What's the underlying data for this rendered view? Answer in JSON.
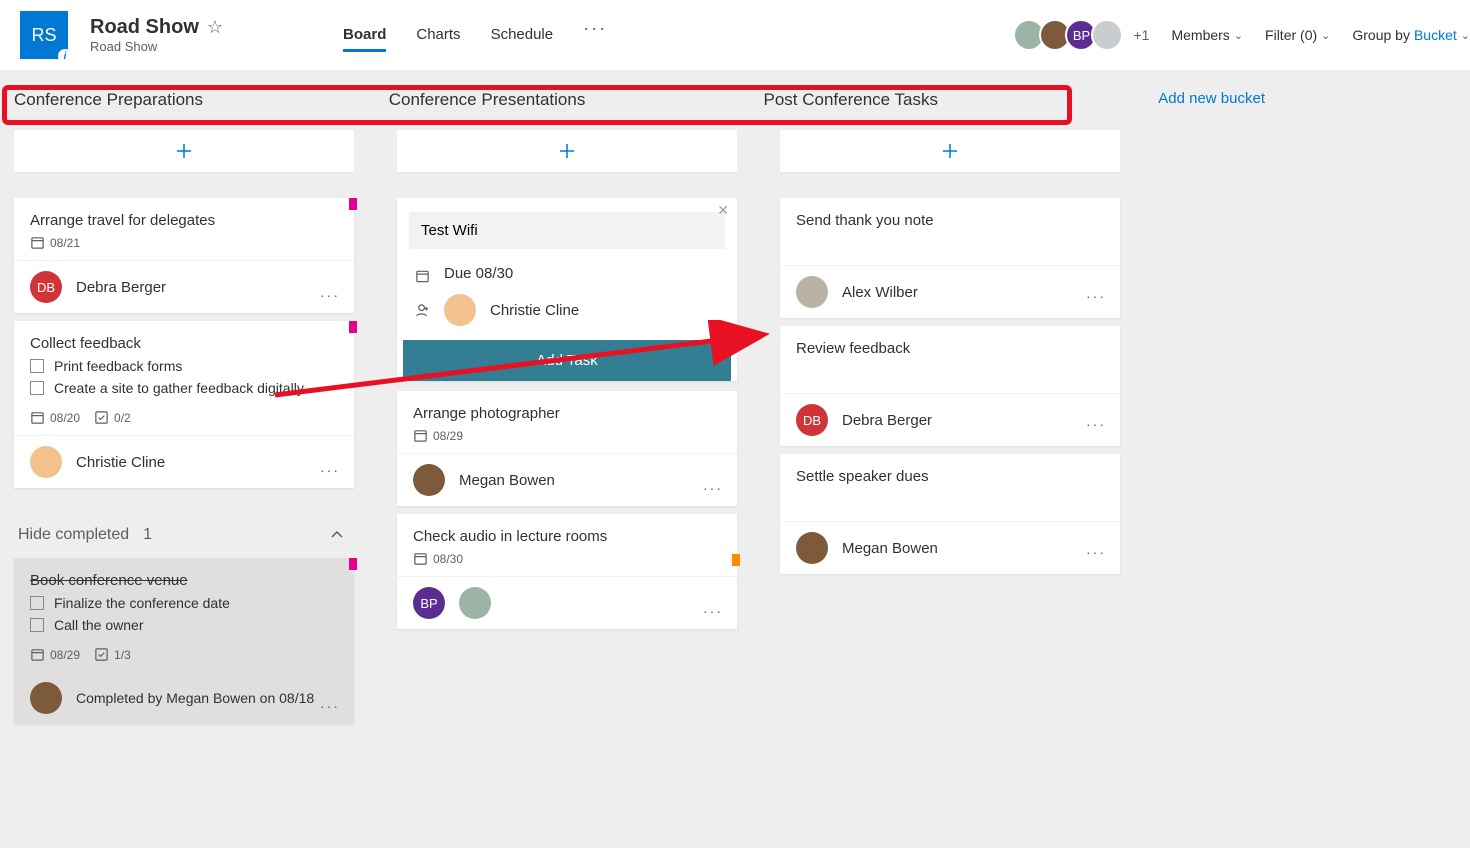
{
  "header": {
    "planInitials": "RS",
    "planTitle": "Road Show",
    "planSub": "Road Show",
    "tabs": {
      "board": "Board",
      "charts": "Charts",
      "schedule": "Schedule"
    },
    "plusCount": "+1",
    "members": "Members",
    "filter": "Filter (0)",
    "groupBy": "Group by",
    "groupByValue": "Bucket"
  },
  "buckets": {
    "confPrep": "Conference Preparations",
    "confPres": "Conference Presentations",
    "postConf": "Post Conference Tasks",
    "addNew": "Add new bucket"
  },
  "col1": {
    "card1": {
      "title": "Arrange travel for delegates",
      "date": "08/21",
      "assignee": "Debra Berger"
    },
    "card2": {
      "title": "Collect feedback",
      "check1": "Print feedback forms",
      "check2": "Create a site to gather feedback digitally",
      "date": "08/20",
      "checkCount": "0/2",
      "assignee": "Christie Cline"
    },
    "hideCompleted": "Hide completed",
    "hideCount": "1",
    "completedCard": {
      "title": "Book conference venue",
      "check1": "Finalize the conference date",
      "check2": "Call the owner",
      "date": "08/29",
      "checkCount": "1/3",
      "completedBy": "Completed by Megan Bowen on 08/18"
    }
  },
  "col2": {
    "newTask": {
      "name": "Test Wifi",
      "due": "Due 08/30",
      "assignee": "Christie Cline",
      "addBtn": "Add Task"
    },
    "card1": {
      "title": "Arrange photographer",
      "date": "08/29",
      "assignee": "Megan Bowen"
    },
    "card2": {
      "title": "Check audio in lecture rooms",
      "date": "08/30"
    }
  },
  "col3": {
    "card1": {
      "title": "Send thank you note",
      "assignee": "Alex Wilber"
    },
    "card2": {
      "title": "Review feedback",
      "assignee": "Debra Berger"
    },
    "card3": {
      "title": "Settle speaker dues",
      "assignee": "Megan Bowen"
    }
  }
}
